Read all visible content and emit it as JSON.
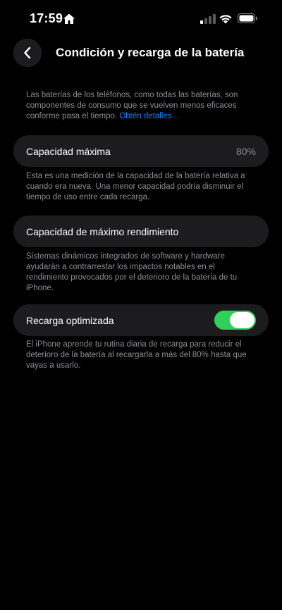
{
  "status_bar": {
    "time": "17:59",
    "home_icon": "home-icon",
    "signal_icon": "cellular-signal-icon",
    "wifi_icon": "wifi-icon",
    "battery_icon": "battery-icon"
  },
  "nav": {
    "back_icon": "chevron-left-icon",
    "title": "Condición y recarga de la batería"
  },
  "intro": {
    "text": "Las baterías de los teléfonos, como todas las baterías, son componentes de consumo que se vuelven menos eficaces conforme pasa el tiempo.",
    "link": "Obtén detalles…"
  },
  "max_capacity": {
    "label": "Capacidad máxima",
    "value": "80%",
    "description": "Esta es una medición de la capacidad de la batería relativa a cuando era nueva. Una menor capacidad podría disminuir el tiempo de uso entre cada recarga."
  },
  "peak_performance": {
    "label": "Capacidad de máximo rendimiento",
    "description": "Sistemas dinámicos integrados de software y hardware ayudarán a contrarrestar los impactos notables en el rendimiento provocados por el deterioro de la batería de tu iPhone."
  },
  "optimized_charging": {
    "label": "Recarga optimizada",
    "enabled": true,
    "description": "El iPhone aprende tu rutina diaria de recarga para reducir el deterioro de la batería al recargarla a más del 80% hasta que vayas a usarlo."
  },
  "colors": {
    "background": "#000000",
    "cell": "#1c1c1e",
    "secondary_text": "#8e8e93",
    "link": "#0a84ff",
    "toggle_on": "#30d158"
  }
}
